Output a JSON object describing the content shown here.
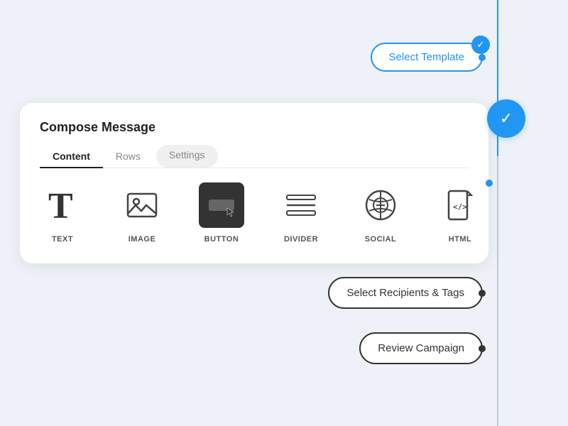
{
  "page": {
    "background": "#eef1f8"
  },
  "header": {
    "title": "Compose Message"
  },
  "tabs": {
    "items": [
      {
        "label": "Content",
        "active": true
      },
      {
        "label": "Rows",
        "active": false
      },
      {
        "label": "Settings",
        "active": false
      }
    ]
  },
  "blocks": [
    {
      "id": "text",
      "label": "TEXT"
    },
    {
      "id": "image",
      "label": "IMAGE"
    },
    {
      "id": "button",
      "label": "BUTTON"
    },
    {
      "id": "divider",
      "label": "DIVIDER"
    },
    {
      "id": "social",
      "label": "SOCIAL"
    },
    {
      "id": "html",
      "label": "HTML"
    }
  ],
  "steps": {
    "select_template": "Select Template",
    "select_recipients": "Select Recipients & Tags",
    "review_campaign": "Review Campaign"
  }
}
